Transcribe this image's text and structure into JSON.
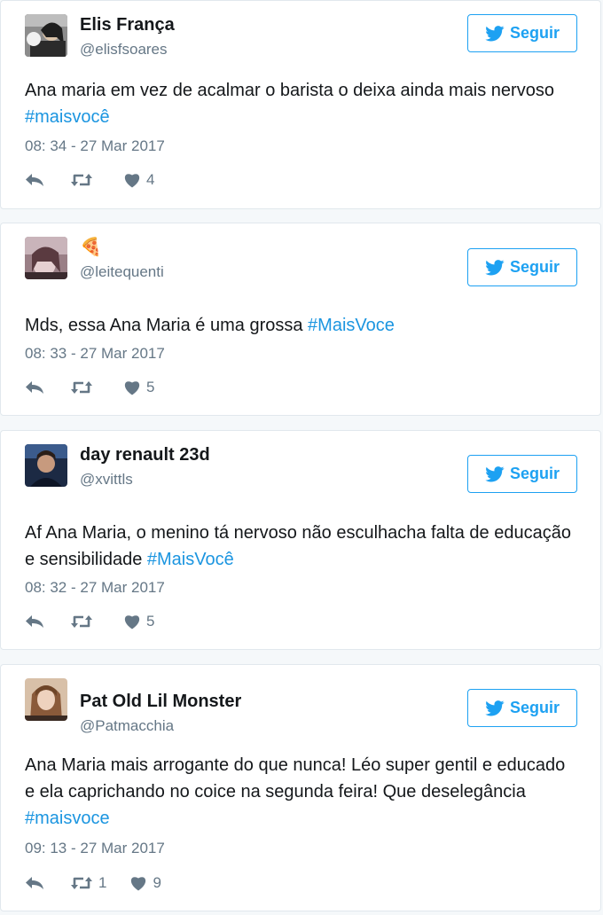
{
  "follow_label": "Seguir",
  "colors": {
    "brand": "#1da1f2",
    "hashtag": "#1b95e0",
    "muted": "#657786"
  },
  "icons": {
    "follow": "twitter-bird-icon",
    "reply": "reply-icon",
    "retweet": "retweet-icon",
    "like": "heart-icon"
  },
  "tweets": [
    {
      "name": "Elis França",
      "handle": "@elisfsoares",
      "text": "Ana maria em vez de acalmar o barista o deixa ainda mais nervoso ",
      "hashtag": "#maisvocê",
      "time": "08: 34 - 27 Mar 2017",
      "retweets": "",
      "likes": "4"
    },
    {
      "name": "🍕",
      "handle": "@leitequenti",
      "text": "Mds, essa Ana Maria é uma grossa ",
      "hashtag": "#MaisVoce",
      "time": "08: 33 - 27 Mar 2017",
      "retweets": "",
      "likes": "5"
    },
    {
      "name": "day renault 23d",
      "handle": "@xvittls",
      "text": "Af Ana Maria, o menino tá nervoso não esculhacha falta de educação e sensibilidade ",
      "hashtag": "#MaisVocê",
      "time": "08: 32 - 27 Mar 2017",
      "retweets": "",
      "likes": "5"
    },
    {
      "name": "Pat Old Lil Monster",
      "handle": "@Patmacchia",
      "text": "Ana Maria mais arrogante do que nunca! Léo super gentil e educado e ela caprichando no coice na segunda feira! Que deselegância ",
      "hashtag": "#maisvoce",
      "time": "09: 13 - 27 Mar 2017",
      "retweets": "1",
      "likes": "9"
    }
  ]
}
